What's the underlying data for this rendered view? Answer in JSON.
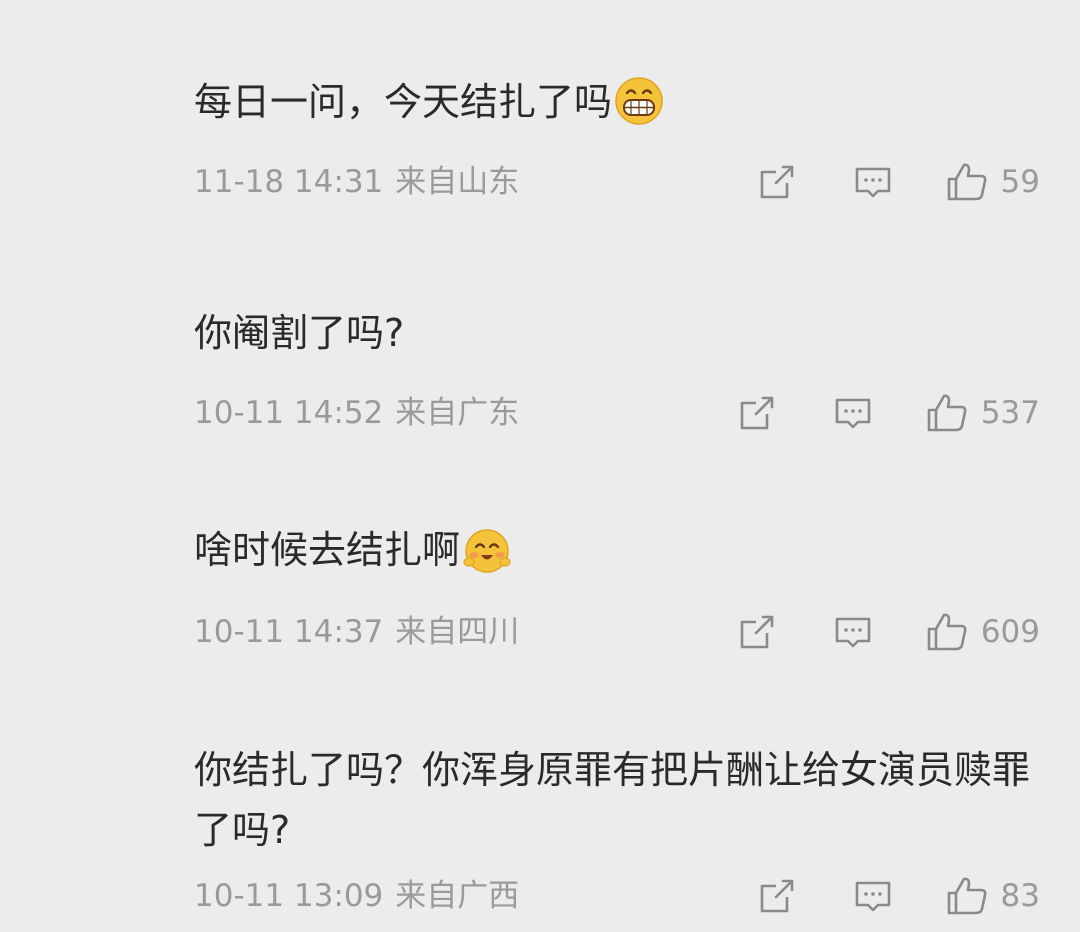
{
  "comments": [
    {
      "text": "每日一问，今天结扎了吗",
      "emoji": "grinning-face-emoji",
      "date": "11-18 14:31",
      "location": "来自山东",
      "likes": "59"
    },
    {
      "text": "你阉割了吗?",
      "emoji": "",
      "date": "10-11 14:52",
      "location": "来自广东",
      "likes": "537"
    },
    {
      "text": "啥时候去结扎啊",
      "emoji": "blushing-face-emoji",
      "date": "10-11 14:37",
      "location": "来自四川",
      "likes": "609"
    },
    {
      "text": "你结扎了吗？你浑身原罪有把片酬让给女演员赎罪了吗?",
      "emoji": "",
      "date": "10-11 13:09",
      "location": "来自广西",
      "likes": "83"
    }
  ],
  "icons": {
    "share": "share-icon",
    "comment": "comment-icon",
    "like": "thumbs-up-icon"
  },
  "colors": {
    "background": "#ececec",
    "text": "#2a2a2a",
    "meta": "#9a9a9a",
    "icon": "#8a8a8a",
    "emoji_yellow": "#f5c33b"
  }
}
